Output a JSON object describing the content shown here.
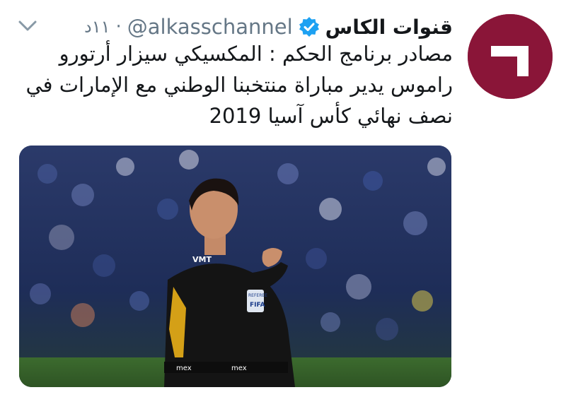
{
  "tweet": {
    "display_name": "قنوات الكاس",
    "handle": "@alkasschannel",
    "separator": "·",
    "time": "١١د",
    "text_lines": [
      "مصادر برنامج الحكم : المكسيكي سيزار أرتورو",
      "راموس يدير مباراة منتخبنا الوطني مع الإمارات في",
      "نصف نهائي كأس آسيا 2019"
    ],
    "icons": {
      "avatar": "alkass-logo",
      "verified": "verified-badge-icon",
      "menu": "chevron-down-icon"
    },
    "media": {
      "shirt_texts": [
        "VMT",
        "REFEREE",
        "FIFA",
        "mex",
        "mex"
      ]
    }
  },
  "colors": {
    "brand": "#8a1538",
    "verified": "#1da1f2",
    "secondary_text": "#657786"
  }
}
